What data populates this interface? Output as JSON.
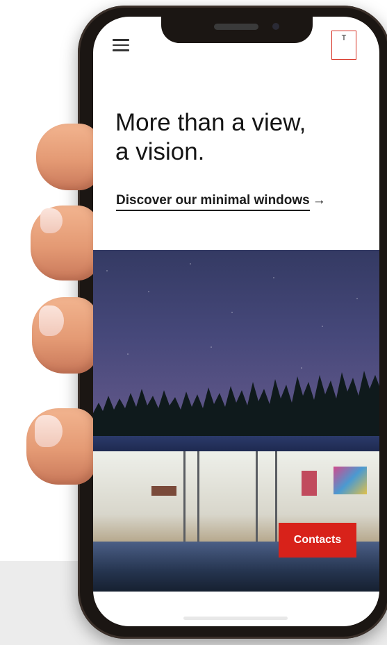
{
  "header": {
    "menu_icon": "hamburger-menu-icon",
    "logo_letter": "T",
    "brand_color": "#d62d1f"
  },
  "hero": {
    "headline_line1": "More than a view,",
    "headline_line2": "a vision.",
    "cta_text": "Discover our minimal windows",
    "cta_arrow": "→"
  },
  "contacts_button": {
    "label": "Contacts",
    "color": "#d8221a"
  }
}
